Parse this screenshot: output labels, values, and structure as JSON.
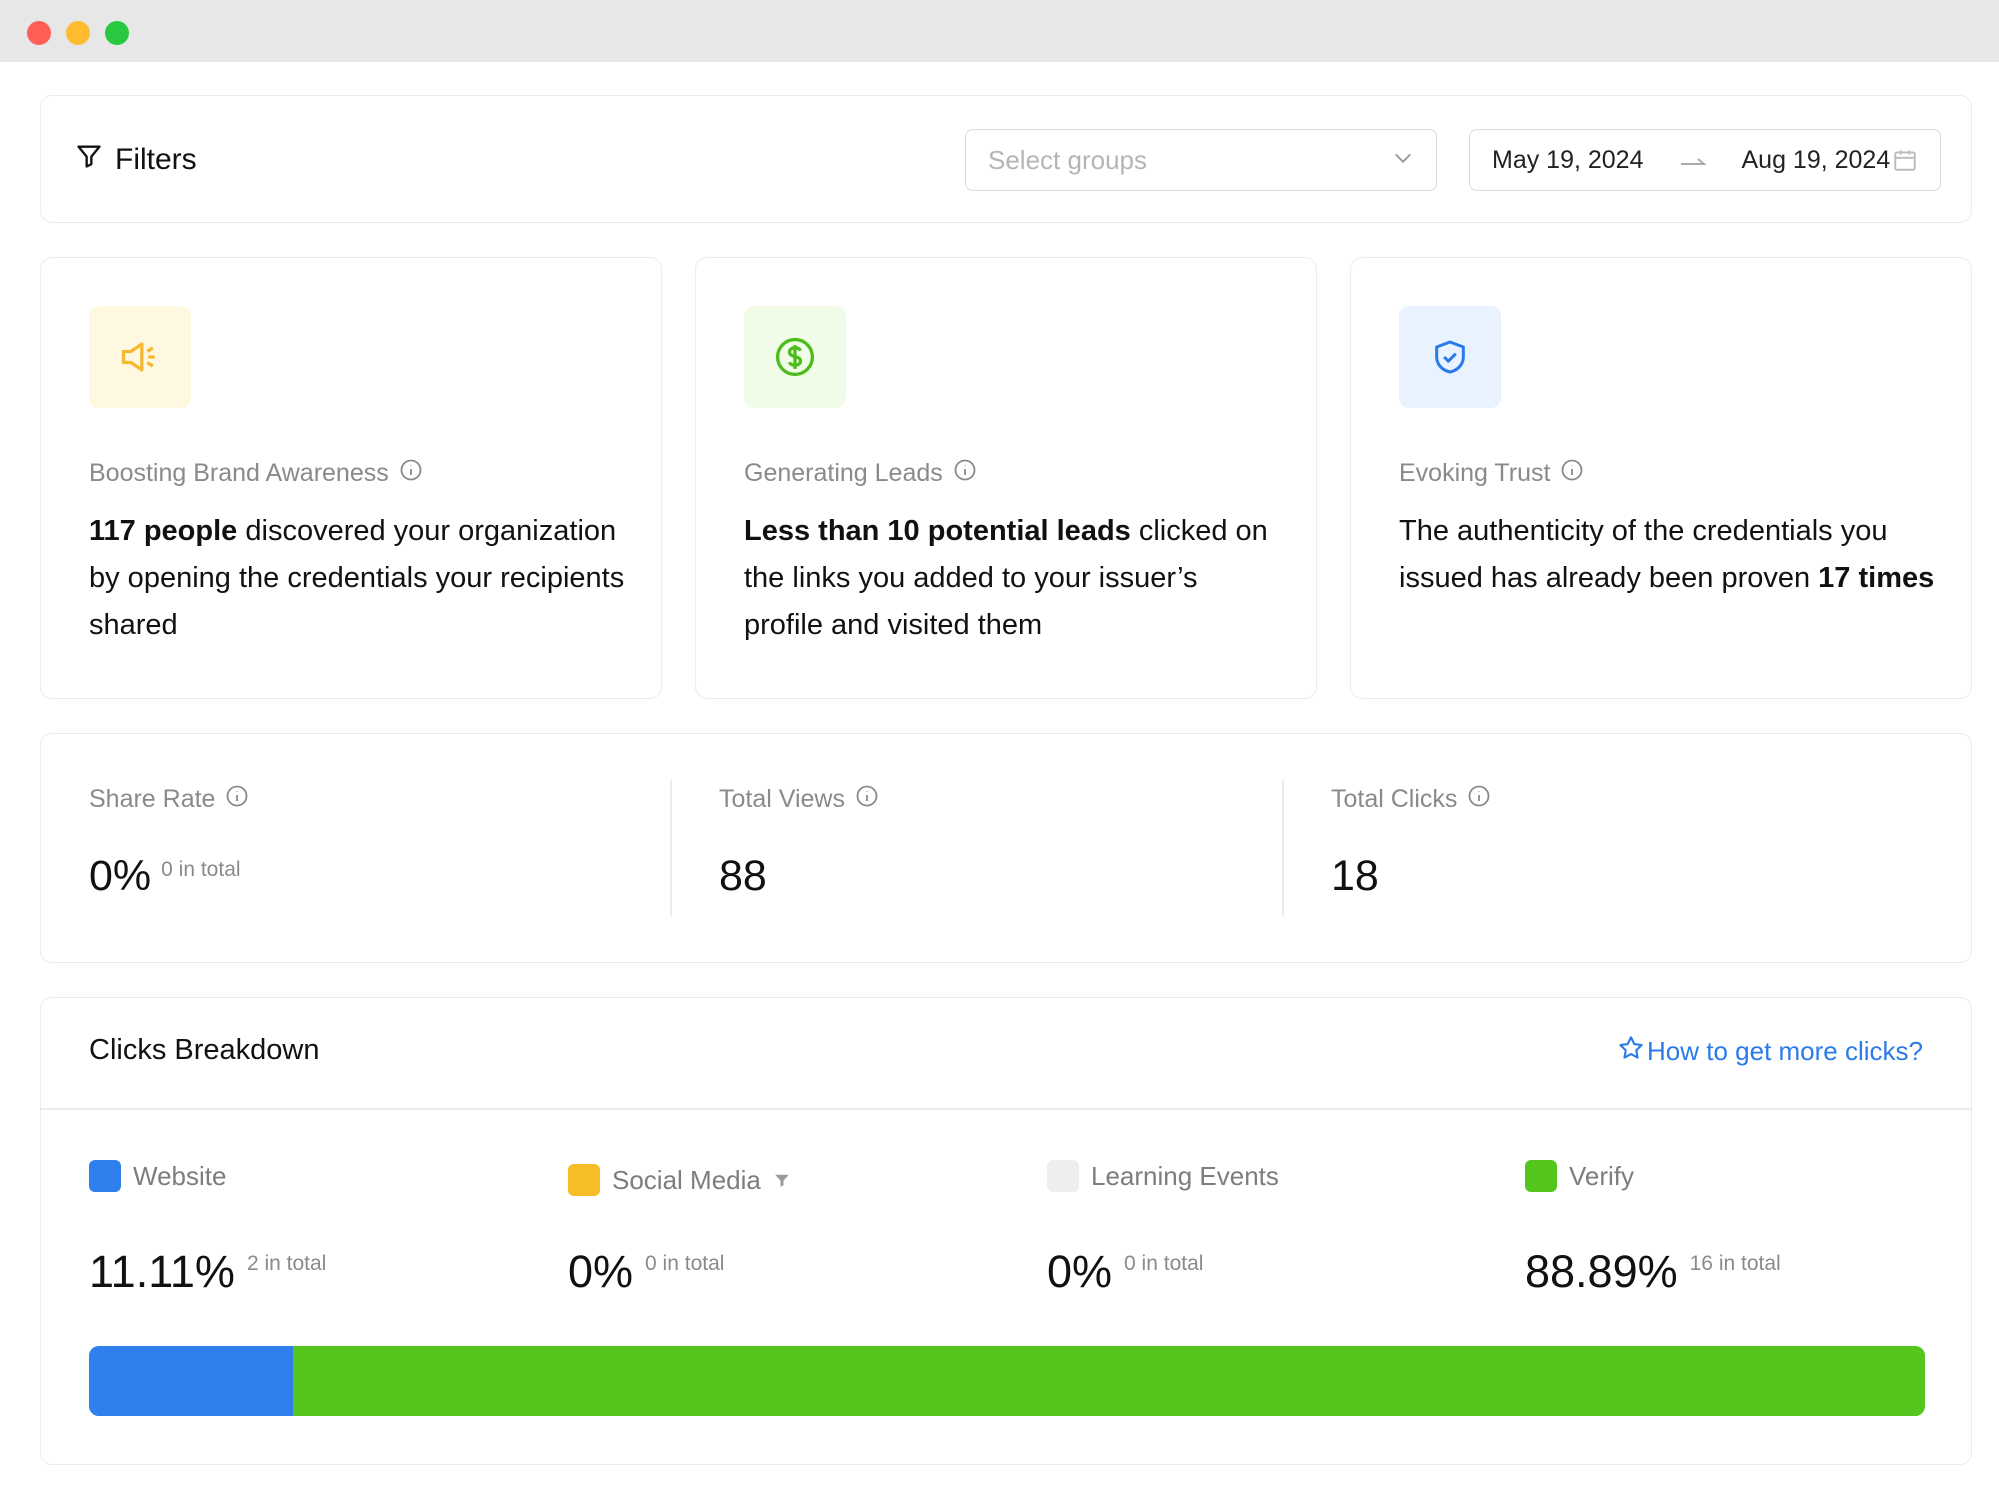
{
  "filters": {
    "title": "Filters",
    "groups_placeholder": "Select groups",
    "date_start": "May 19, 2024",
    "date_end": "Aug 19, 2024"
  },
  "insights": [
    {
      "label": "Boosting Brand Awareness",
      "bold": "117 people",
      "text": " discovered your organization by opening the credentials your recipients shared",
      "icon": "megaphone-icon",
      "icon_bg": "#fff8e1",
      "icon_color": "#f5b82e"
    },
    {
      "label": "Generating Leads",
      "bold": "Less than 10 potential leads",
      "text": " clicked on the links you added to your issuer’s profile and visited them",
      "icon": "dollar-icon",
      "icon_bg": "#f0fce8",
      "icon_color": "#4dbd1c"
    },
    {
      "label": "Evoking Trust",
      "text": "The authenticity of the credentials you issued has already been proven ",
      "bold": "17 times",
      "icon": "shield-check-icon",
      "icon_bg": "#e8f3ff",
      "icon_color": "#2a7ae9"
    }
  ],
  "stats": {
    "share_rate": {
      "label": "Share Rate",
      "value": "0%",
      "sub": "0 in total"
    },
    "total_views": {
      "label": "Total Views",
      "value": "88"
    },
    "total_clicks": {
      "label": "Total Clicks",
      "value": "18"
    }
  },
  "breakdown": {
    "title": "Clicks Breakdown",
    "link": "How to get more clicks?",
    "items": [
      {
        "label": "Website",
        "pct": "11.11%",
        "sub": "2 in total",
        "color": "#2f80ed",
        "share": 0.1111
      },
      {
        "label": "Social Media",
        "pct": "0%",
        "sub": "0 in total",
        "color": "#f6bd25",
        "share": 0
      },
      {
        "label": "Learning Events",
        "pct": "0%",
        "sub": "0 in total",
        "color": "#eeeeee",
        "share": 0
      },
      {
        "label": "Verify",
        "pct": "88.89%",
        "sub": "16 in total",
        "color": "#53c51c",
        "share": 0.8889
      }
    ]
  }
}
